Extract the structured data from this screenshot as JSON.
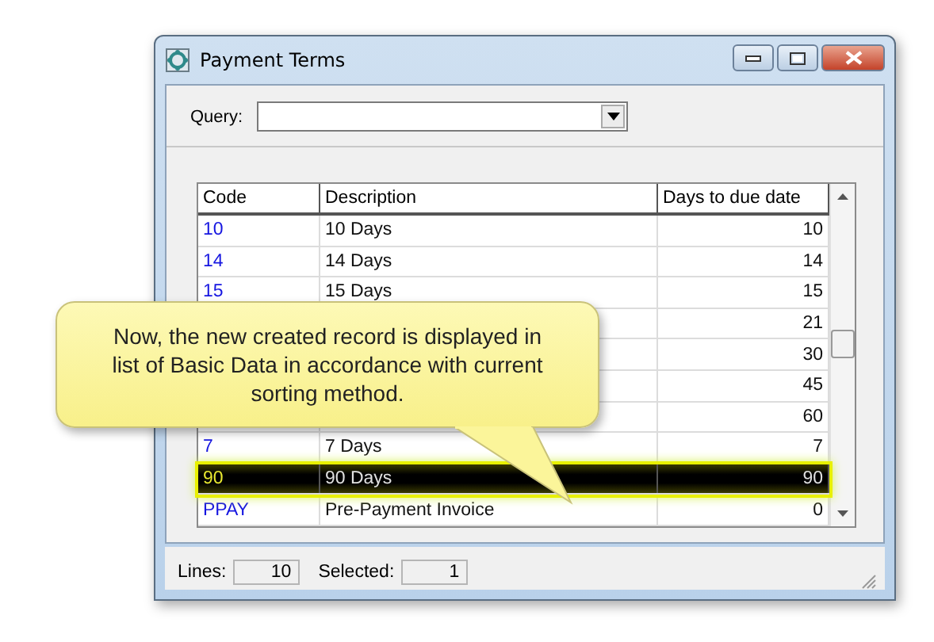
{
  "window": {
    "title": "Payment Terms"
  },
  "query": {
    "label": "Query:"
  },
  "table": {
    "columns": [
      "Code",
      "Description",
      "Days to due date"
    ],
    "rows": [
      {
        "code": "10",
        "description": "10 Days",
        "days": "10",
        "selected": false
      },
      {
        "code": "14",
        "description": "14 Days",
        "days": "14",
        "selected": false
      },
      {
        "code": "15",
        "description": "15 Days",
        "days": "15",
        "selected": false
      },
      {
        "days": "21",
        "selected": false
      },
      {
        "days": "30",
        "selected": false
      },
      {
        "days": "45",
        "selected": false
      },
      {
        "days": "60",
        "selected": false
      },
      {
        "code": "7",
        "description": "7 Days",
        "days": "7",
        "selected": false
      },
      {
        "code": "90",
        "description": "90 Days",
        "days": "90",
        "selected": true
      },
      {
        "code": "PPAY",
        "description": "Pre-Payment Invoice",
        "days": "0",
        "selected": false
      }
    ]
  },
  "status_bar": {
    "lines_label": "Lines:",
    "lines": "10",
    "selected_label": "Selected:",
    "selected": "1"
  },
  "callout": {
    "text": "Now, the new created record is displayed in list of Basic Data in accordance with current sorting method."
  }
}
